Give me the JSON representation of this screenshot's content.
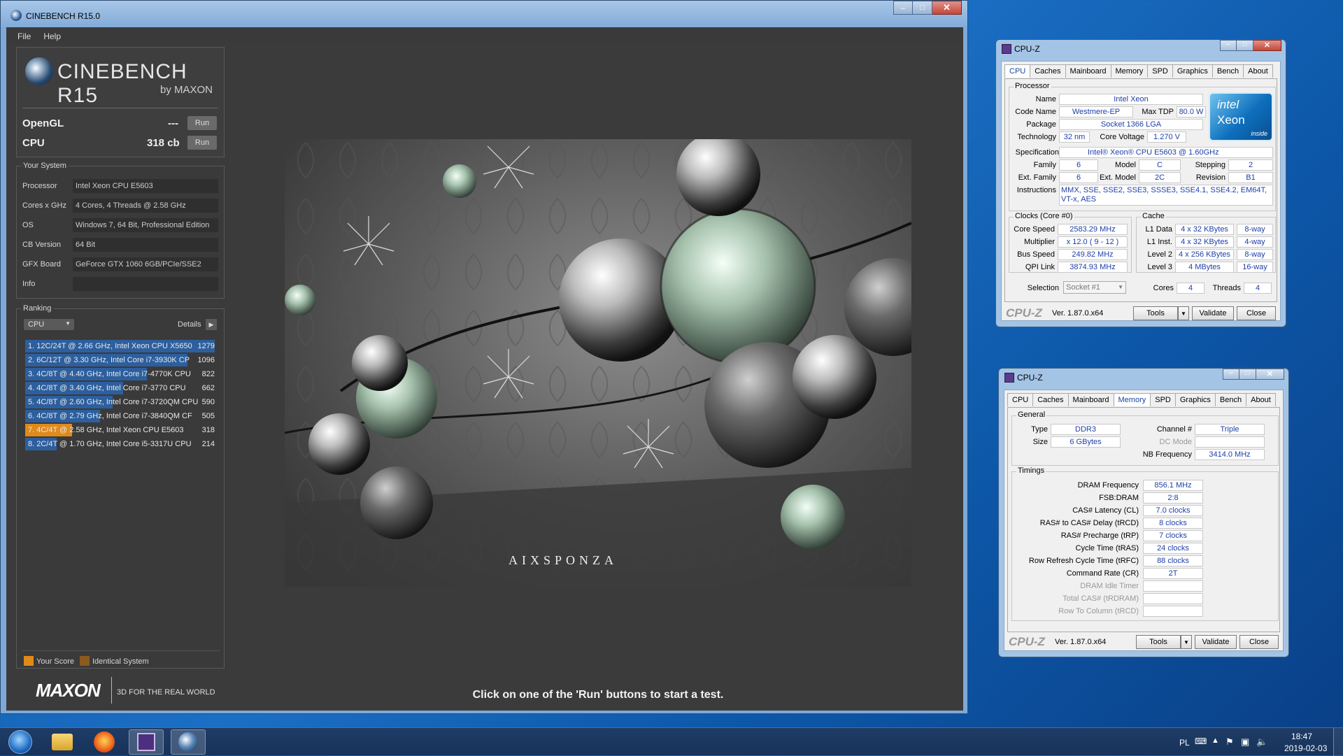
{
  "cinebench": {
    "title": "CINEBENCH R15.0",
    "menu": [
      "File",
      "Help"
    ],
    "logo": {
      "main": "CINEBENCH R15",
      "sub": "by MAXON"
    },
    "tests": [
      {
        "label": "OpenGL",
        "score": "---",
        "button": "Run"
      },
      {
        "label": "CPU",
        "score": "318 cb",
        "button": "Run"
      }
    ],
    "your_system": {
      "heading": "Your System",
      "rows": [
        {
          "label": "Processor",
          "value": "Intel Xeon CPU E5603"
        },
        {
          "label": "Cores x GHz",
          "value": "4 Cores, 4 Threads @ 2.58 GHz"
        },
        {
          "label": "OS",
          "value": "Windows 7, 64 Bit, Professional Edition"
        },
        {
          "label": "CB Version",
          "value": "64 Bit"
        },
        {
          "label": "GFX Board",
          "value": "GeForce GTX 1060 6GB/PCIe/SSE2"
        },
        {
          "label": "Info",
          "value": ""
        }
      ]
    },
    "ranking": {
      "heading": "Ranking",
      "select": "CPU",
      "details": "Details",
      "rows": [
        {
          "text": "1. 12C/24T @ 2.66 GHz, Intel Xeon CPU X5650",
          "score": 1279,
          "kind": "other"
        },
        {
          "text": "2. 6C/12T @ 3.30 GHz,  Intel Core i7-3930K CP",
          "score": 1096,
          "kind": "other"
        },
        {
          "text": "3. 4C/8T @ 4.40 GHz, Intel Core i7-4770K CPU",
          "score": 822,
          "kind": "other"
        },
        {
          "text": "4. 4C/8T @ 3.40 GHz,  Intel Core i7-3770 CPU",
          "score": 662,
          "kind": "other"
        },
        {
          "text": "5. 4C/8T @ 2.60 GHz, Intel Core i7-3720QM CPU",
          "score": 590,
          "kind": "other"
        },
        {
          "text": "6. 4C/8T @ 2.79 GHz,  Intel Core i7-3840QM CF",
          "score": 505,
          "kind": "other"
        },
        {
          "text": "7. 4C/4T @ 2.58 GHz, Intel Xeon CPU E5603",
          "score": 318,
          "kind": "yours"
        },
        {
          "text": "8. 2C/4T @ 1.70 GHz,  Intel Core i5-3317U CPU",
          "score": 214,
          "kind": "other"
        }
      ],
      "max_score": 1279
    },
    "legend": {
      "your_score": "Your Score",
      "identical": "Identical System"
    },
    "footer_brand": "MAXON",
    "footer_tagline": "3D FOR THE REAL WORLD",
    "status": "Click on one of the 'Run' buttons to start a test.",
    "render_brand": "AIXSPONZA",
    "colors": {
      "bar": "#2d5f9e",
      "yours": "#e08a1b",
      "identical": "#8a5a1e"
    }
  },
  "cpuz1": {
    "title": "CPU-Z",
    "tabs": [
      "CPU",
      "Caches",
      "Mainboard",
      "Memory",
      "SPD",
      "Graphics",
      "Bench",
      "About"
    ],
    "active_tab": "CPU",
    "processor": {
      "heading": "Processor",
      "name": "Intel Xeon",
      "code_name": "Westmere-EP",
      "max_tdp": "80.0 W",
      "package": "Socket 1366 LGA",
      "technology": "32 nm",
      "core_voltage": "1.270 V",
      "specification": "Intel® Xeon® CPU        E5603  @ 1.60GHz",
      "family": "6",
      "model": "C",
      "stepping": "2",
      "ext_family": "6",
      "ext_model": "2C",
      "revision": "B1",
      "instructions": "MMX, SSE, SSE2, SSE3, SSSE3, SSE4.1, SSE4.2, EM64T, VT-x, AES"
    },
    "labels": {
      "name": "Name",
      "code_name": "Code Name",
      "max_tdp": "Max TDP",
      "package": "Package",
      "technology": "Technology",
      "core_voltage": "Core Voltage",
      "specification": "Specification",
      "family": "Family",
      "model": "Model",
      "stepping": "Stepping",
      "ext_family": "Ext. Family",
      "ext_model": "Ext. Model",
      "revision": "Revision",
      "instructions": "Instructions"
    },
    "logo": {
      "brand": "intel",
      "product": "Xeon",
      "tag": "inside"
    },
    "clocks": {
      "heading": "Clocks (Core #0)",
      "rows": [
        {
          "label": "Core Speed",
          "value": "2583.29 MHz"
        },
        {
          "label": "Multiplier",
          "value": "x 12.0 ( 9 - 12 )"
        },
        {
          "label": "Bus Speed",
          "value": "249.82 MHz"
        },
        {
          "label": "QPI Link",
          "value": "3874.93 MHz"
        }
      ]
    },
    "cache": {
      "heading": "Cache",
      "rows": [
        {
          "label": "L1 Data",
          "size": "4 x 32 KBytes",
          "way": "8-way"
        },
        {
          "label": "L1 Inst.",
          "size": "4 x 32 KBytes",
          "way": "4-way"
        },
        {
          "label": "Level 2",
          "size": "4 x 256 KBytes",
          "way": "8-way"
        },
        {
          "label": "Level 3",
          "size": "4 MBytes",
          "way": "16-way"
        }
      ]
    },
    "selection_label": "Selection",
    "selection": "Socket #1",
    "cores_label": "Cores",
    "cores": "4",
    "threads_label": "Threads",
    "threads": "4",
    "footer_logo": "CPU-Z",
    "version": "Ver. 1.87.0.x64",
    "tools": "Tools",
    "validate": "Validate",
    "close": "Close"
  },
  "cpuz2": {
    "title": "CPU-Z",
    "tabs": [
      "CPU",
      "Caches",
      "Mainboard",
      "Memory",
      "SPD",
      "Graphics",
      "Bench",
      "About"
    ],
    "active_tab": "Memory",
    "general": {
      "heading": "General",
      "type_label": "Type",
      "type": "DDR3",
      "size_label": "Size",
      "size": "6 GBytes",
      "channel_label": "Channel #",
      "channel": "Triple",
      "dc_label": "DC Mode",
      "dc": "",
      "nb_label": "NB Frequency",
      "nb": "3414.0 MHz"
    },
    "timings": {
      "heading": "Timings",
      "rows": [
        {
          "label": "DRAM Frequency",
          "value": "856.1 MHz",
          "dim": false
        },
        {
          "label": "FSB:DRAM",
          "value": "2:8",
          "dim": false
        },
        {
          "label": "CAS# Latency (CL)",
          "value": "7.0 clocks",
          "dim": false
        },
        {
          "label": "RAS# to CAS# Delay (tRCD)",
          "value": "8 clocks",
          "dim": false
        },
        {
          "label": "RAS# Precharge (tRP)",
          "value": "7 clocks",
          "dim": false
        },
        {
          "label": "Cycle Time (tRAS)",
          "value": "24 clocks",
          "dim": false
        },
        {
          "label": "Row Refresh Cycle Time (tRFC)",
          "value": "88 clocks",
          "dim": false
        },
        {
          "label": "Command Rate (CR)",
          "value": "2T",
          "dim": false
        },
        {
          "label": "DRAM Idle Timer",
          "value": "",
          "dim": true
        },
        {
          "label": "Total CAS# (tRDRAM)",
          "value": "",
          "dim": true
        },
        {
          "label": "Row To Column (tRCD)",
          "value": "",
          "dim": true
        }
      ]
    },
    "footer_logo": "CPU-Z",
    "version": "Ver. 1.87.0.x64",
    "tools": "Tools",
    "validate": "Validate",
    "close": "Close"
  },
  "taskbar": {
    "icons": [
      "start-orb-icon",
      "explorer-icon",
      "firefox-icon",
      "cpuz-icon",
      "cinebench-icon"
    ],
    "lang": "PL",
    "time": "18:47",
    "date": "2019-02-03"
  }
}
